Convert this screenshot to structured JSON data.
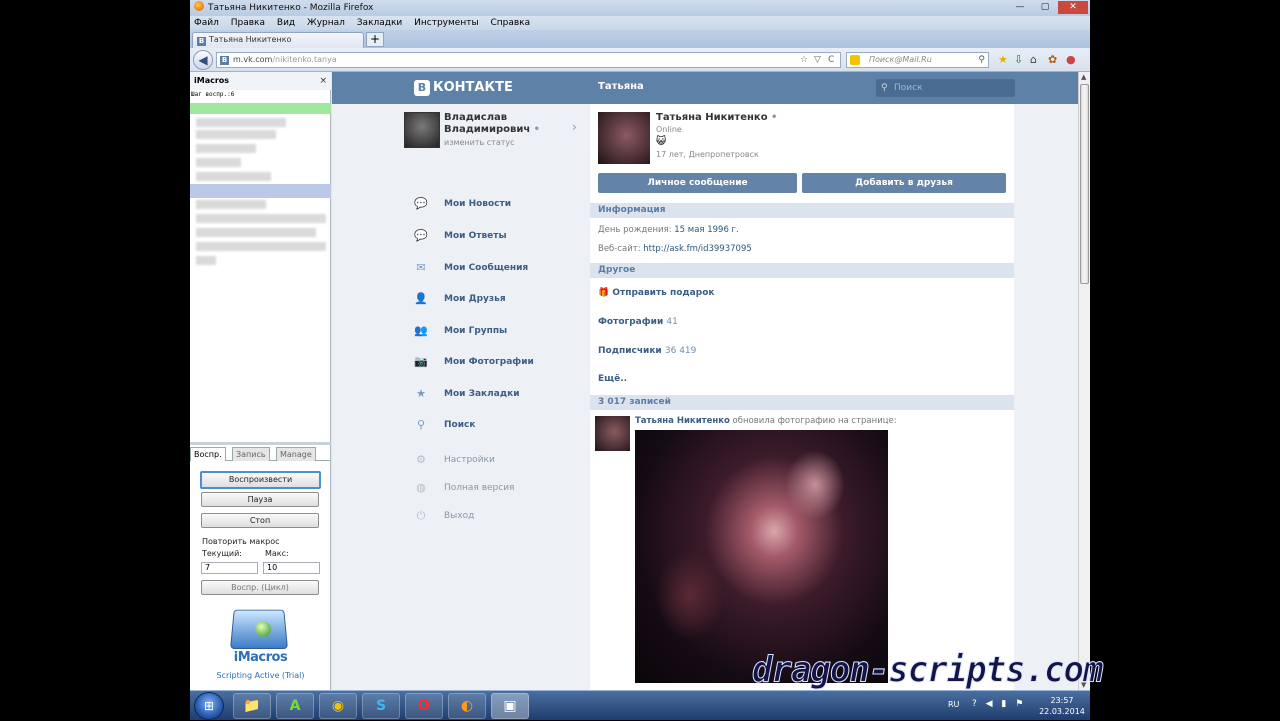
{
  "window": {
    "title": "Татьяна Никитенко - Mozilla Firefox",
    "min_glyph": "—",
    "max_glyph": "▢",
    "close_glyph": "✕"
  },
  "menu": [
    "Файл",
    "Правка",
    "Вид",
    "Журнал",
    "Закладки",
    "Инструменты",
    "Справка"
  ],
  "tab": {
    "label": "Татьяна Никитенко",
    "favicon": "B",
    "new_tab_glyph": "+"
  },
  "nav": {
    "back_glyph": "◀",
    "url_host": "m.vk.com",
    "url_path": "/nikitenko.tanya",
    "search_placeholder": "Поиск@Mail.Ru",
    "star_glyph": "☆",
    "dropdown_glyph": "▽",
    "reload_glyph": "C",
    "mag_glyph": "⚲"
  },
  "imacros": {
    "panel_title": "iMacros",
    "close_glyph": "×",
    "step_text": "Шаг воспр.:6",
    "tabs": [
      "Воспр.",
      "Запись",
      "Manage"
    ],
    "play_label": "Воспроизвести",
    "pause_label": "Пауза",
    "stop_label": "Стоп",
    "repeat_label": "Повторить макрос",
    "current_label": "Текущий:",
    "max_label": "Макс:",
    "current_value": "7",
    "max_value": "10",
    "loop_label": "Воспр. (Цикл)",
    "logo_text": "iMacros",
    "status_text": "Scripting Active (Trial)"
  },
  "vk": {
    "logo_letter": "B",
    "logo_text": "КОНТАКТЕ",
    "page_title": "Татьяна",
    "search_placeholder": "Поиск",
    "search_glyph": "⚲",
    "me": {
      "name": "Владислав Владимирович",
      "status": "изменить статус",
      "online_dot": "•",
      "arrow": "›"
    },
    "menu": [
      {
        "label": "Мои Новости",
        "icon": "💬"
      },
      {
        "label": "Мои Ответы",
        "icon": "💬"
      },
      {
        "label": "Мои Сообщения",
        "icon": "✉"
      },
      {
        "label": "Мои Друзья",
        "icon": "👤"
      },
      {
        "label": "Мои Группы",
        "icon": "👥"
      },
      {
        "label": "Мои Фотографии",
        "icon": "📷"
      },
      {
        "label": "Мои Закладки",
        "icon": "★"
      },
      {
        "label": "Поиск",
        "icon": "⚲"
      }
    ],
    "secondary_menu": [
      {
        "label": "Настройки",
        "icon": "⚙"
      },
      {
        "label": "Полная версия",
        "icon": "◍"
      },
      {
        "label": "Выход",
        "icon": "⏻"
      }
    ],
    "profile": {
      "name": "Татьяна Никитенко",
      "online_dot": "•",
      "online": "Online",
      "emoji": "😺",
      "info": "17 лет, Днепропетровск",
      "msg_button": "Личное сообщение",
      "friend_button": "Добавить в друзья"
    },
    "info_section": {
      "title": "Информация",
      "birthday_label": "День рождения:",
      "birthday_value": "15 мая 1996 г.",
      "site_label": "Веб-сайт:",
      "site_value": "http://ask.fm/id39937095"
    },
    "other_section": {
      "title": "Другое",
      "gift_icon": "🎁",
      "gift": "Отправить подарок",
      "photos_label": "Фотографии",
      "photos_count": "41",
      "subs_label": "Подписчики",
      "subs_count": "36 419",
      "more": "Ещё.."
    },
    "wall": {
      "title": "3 017 записей",
      "post_author": "Татьяна Никитенко",
      "post_action": "обновила фотографию на странице:"
    }
  },
  "watermark": "dragon-scripts.com",
  "taskbar": {
    "start_glyph": "⊞",
    "apps": [
      {
        "name": "explorer",
        "glyph": "📁"
      },
      {
        "name": "app-a",
        "glyph": "A"
      },
      {
        "name": "chrome",
        "glyph": "◉"
      },
      {
        "name": "skype",
        "glyph": "S"
      },
      {
        "name": "opera",
        "glyph": "O"
      },
      {
        "name": "firefox",
        "glyph": "◐"
      },
      {
        "name": "app-active",
        "glyph": "▣"
      }
    ],
    "lang": "RU",
    "tray_icons": "? ◀ ▮ ⚑",
    "time": "23:57",
    "date": "22.03.2014"
  },
  "colors": {
    "vk_blue": "#5e81a8",
    "link": "#3c5d86",
    "imacros_blue": "#2f6dbd",
    "green_row": "#9fe8a0"
  }
}
